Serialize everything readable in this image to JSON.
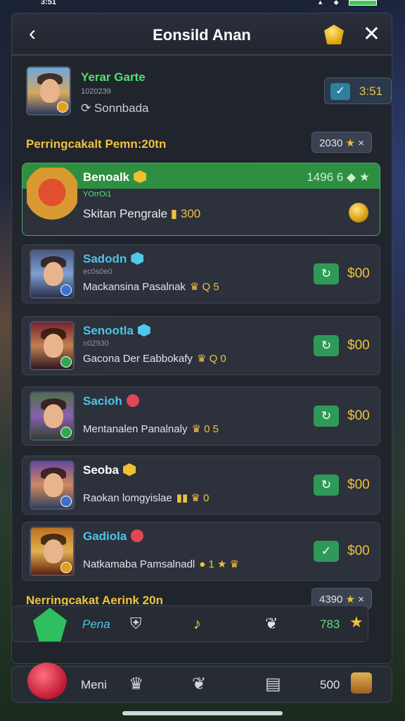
{
  "status_bar": {
    "time": "3:51"
  },
  "header": {
    "title": "Eonsild Anan",
    "back": "‹",
    "close": "✕"
  },
  "profile": {
    "name": "Yerar Garte",
    "sub": "1020239",
    "status": "Sonnbada",
    "button_value": "3:51"
  },
  "section1": {
    "label": "Perringcakalt Pemn:20tn",
    "pill_value": "2030",
    "pill_close": "×"
  },
  "featured": {
    "name": "Benoalk",
    "sub": "YOrrOi1",
    "desc": "Skitan Pengrale",
    "desc_value": "300",
    "count": "1496 6"
  },
  "rows": [
    {
      "name": "Sadodn",
      "sub": "ec0s0e0",
      "desc": "Mackansina Pasalnak",
      "loot": "Q 5",
      "button": "↻",
      "price": "$00"
    },
    {
      "name": "Senootla",
      "sub": "n02930",
      "desc": "Gacona Der Eabbokafy",
      "loot": "Q 0",
      "button": "↻",
      "price": "$00"
    },
    {
      "name": "Sacioh",
      "sub": "",
      "desc": "Mentanalen Panalnaly",
      "loot": "0 5",
      "button": "↻",
      "price": "$00"
    },
    {
      "name": "Seoba",
      "sub": "",
      "desc": "Raokan lomgyislae",
      "loot": "0",
      "button": "↻",
      "price": "$00"
    },
    {
      "name": "Gadiola",
      "sub": "",
      "desc": "Natkamaba Pamsalnadl",
      "loot": "1",
      "button": "✓",
      "price": "$00"
    }
  ],
  "section2": {
    "label": "Nerringcakat Aerink 20n",
    "pill_value": "4390",
    "pill_close": "×"
  },
  "stats_bar": {
    "label": "Pena",
    "value": "783",
    "arrow": "›"
  },
  "bottom_nav": {
    "label": "Meni",
    "value": "500"
  },
  "colors": {
    "accent_green": "#2f8f40",
    "gold": "#f0c040",
    "cyan": "#4cc4e8"
  }
}
